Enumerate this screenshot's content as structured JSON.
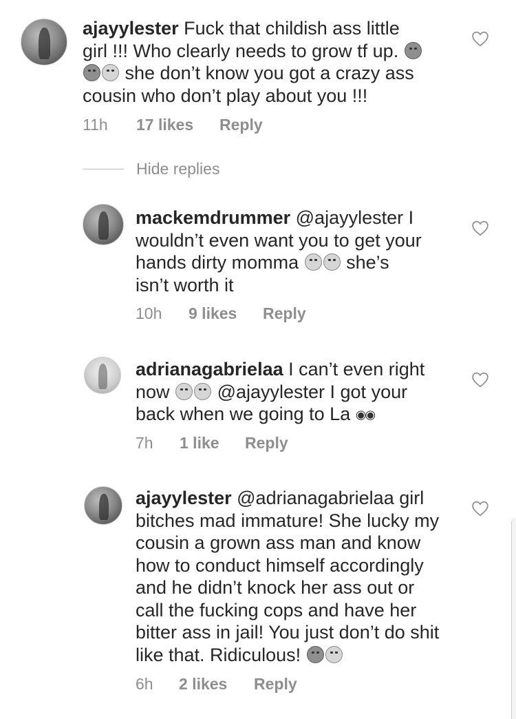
{
  "comments": [
    {
      "username": "ajayylester",
      "line1": "Fuck that childish ass little",
      "line2": "girl !!! Who clearly needs to grow tf up.",
      "line3": "she don’t know you got a crazy ass",
      "line4": "cousin who don’t play about you !!!",
      "time": "11h",
      "likes": "17 likes",
      "reply": "Reply"
    },
    {
      "username": "mackemdrummer",
      "line1": "@ajayylester I",
      "line2": "wouldn’t even want you to get your",
      "line3a": "hands dirty momma",
      "line3b": "she’s",
      "line4": "isn’t worth it",
      "time": "10h",
      "likes": "9 likes",
      "reply": "Reply"
    },
    {
      "username": "adrianagabrielaa",
      "line1": "I can’t even right",
      "line2a": "now",
      "line2b": "@ajayylester I got your",
      "line3": "back when we going to La",
      "time": "7h",
      "likes": "1 like",
      "reply": "Reply"
    },
    {
      "username": "ajayylester",
      "line1": "@adrianagabrielaa girl",
      "line2": "bitches mad immature! She lucky my",
      "line3": "cousin a grown ass man and know",
      "line4": "how to conduct himself accordingly",
      "line5": "and he didn’t knock her ass out or",
      "line6": "call the fucking cops and have her",
      "line7": "bitter ass in jail! You just don’t do shit",
      "line8": "like that. Ridiculous!",
      "time": "6h",
      "likes": "2 likes",
      "reply": "Reply"
    }
  ],
  "hide_replies": "Hide replies",
  "icons": {
    "like": "heart-outline-icon",
    "avatar": "profile-avatar"
  }
}
